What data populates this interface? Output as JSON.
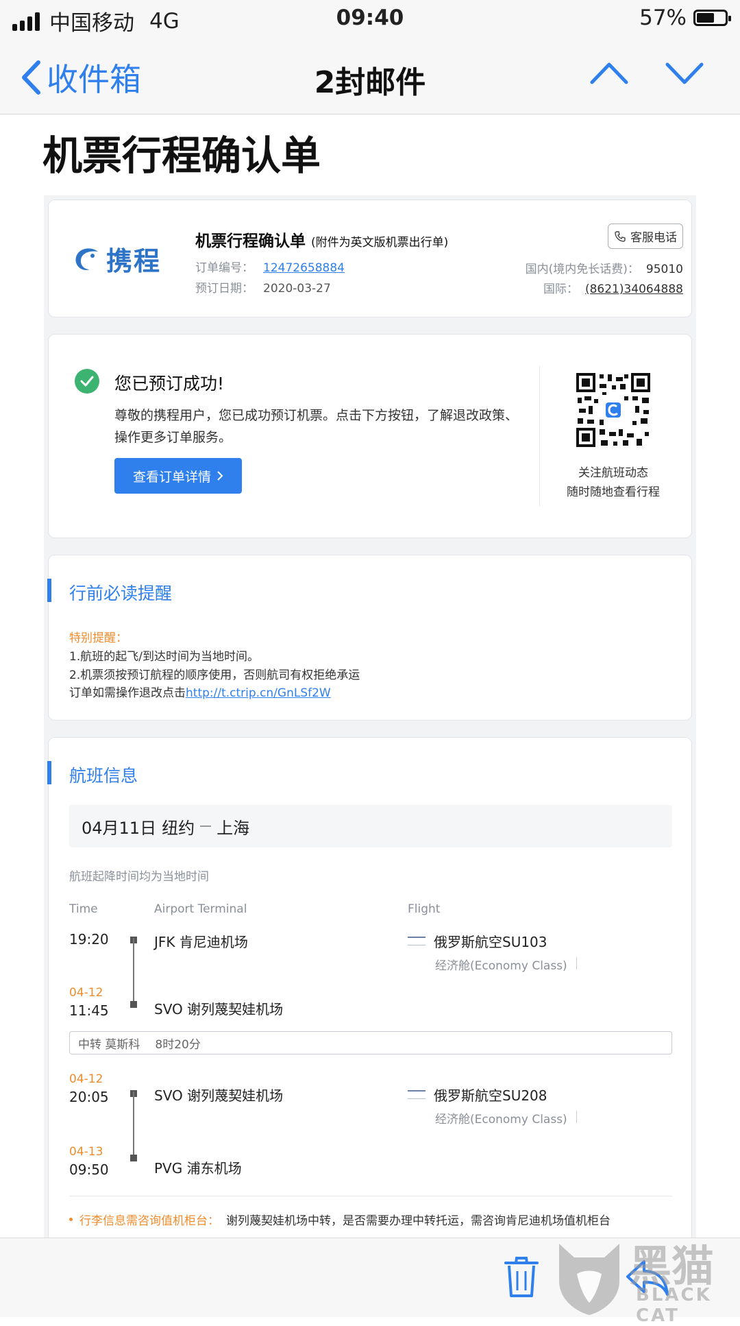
{
  "status_bar": {
    "carrier": "中国移动",
    "network": "4G",
    "time": "09:40",
    "battery": "57%",
    "battery_level": 0.57
  },
  "nav": {
    "back_label": "收件箱",
    "title": "2封邮件"
  },
  "page_heading": "机票行程确认单",
  "header_card": {
    "logo_text": "携程",
    "title": "机票行程确认单",
    "title_note": "(附件为英文版机票出行单)",
    "order_no_label": "订单编号：",
    "order_no": "12472658884",
    "order_date_label": "预订日期：",
    "order_date": "2020-03-27",
    "service_button": "客服电话",
    "domestic_label": "国内(境内免长话费)：",
    "domestic_phone": "95010",
    "intl_label": "国际：",
    "intl_phone": "(8621)34064888"
  },
  "success_card": {
    "heading": "您已预订成功!",
    "body": "尊敬的携程用户，您已成功预订机票。点击下方按钮，了解退改政策、操作更多订单服务。",
    "button": "查看订单详情",
    "qr_caption_1": "关注航班动态",
    "qr_caption_2": "随时随地查看行程"
  },
  "reminder_card": {
    "title": "行前必读提醒",
    "warning_label": "特别提醒：",
    "line1": "1.航班的起飞/到达时间为当地时间。",
    "line2": "2.机票须按预订航程的顺序使用，否则航司有权拒绝承运",
    "line3_prefix": "订单如需操作退改点击",
    "link": "http://t.ctrip.cn/GnLSf2W"
  },
  "flight_card": {
    "title": "航班信息",
    "route_date": "04月11日",
    "route_from": "纽约",
    "route_to": "上海",
    "note": "航班起降时间均为当地时间",
    "col_time": "Time",
    "col_airport": "Airport Terminal",
    "col_flight": "Flight",
    "segments": [
      {
        "dep_date": "",
        "dep_time": "19:20",
        "dep_airport": "JFK 肯尼迪机场",
        "arr_date": "04-12",
        "arr_time": "11:45",
        "arr_airport": "SVO 谢列蔑契娃机场",
        "airline": "俄罗斯航空SU103",
        "cabin": "经济舱(Economy Class)"
      },
      {
        "dep_date": "04-12",
        "dep_time": "20:05",
        "dep_airport": "SVO 谢列蔑契娃机场",
        "arr_date": "04-13",
        "arr_time": "09:50",
        "arr_airport": "PVG 浦东机场",
        "airline": "俄罗斯航空SU208",
        "cabin": "经济舱(Economy Class)"
      }
    ],
    "transfer_city": "中转 莫斯科",
    "transfer_duration": "8时20分",
    "baggage_label": "行李信息需咨询值机柜台：",
    "baggage_text": "谢列蔑契娃机场中转，是否需要办理中转托运，需咨询肯尼迪机场值机柜台"
  },
  "watermark": {
    "cn": "黑猫",
    "en": "BLACK CAT"
  },
  "colors": {
    "accent": "#2f80ed",
    "warning": "#f08c2c",
    "success": "#3cb371"
  }
}
